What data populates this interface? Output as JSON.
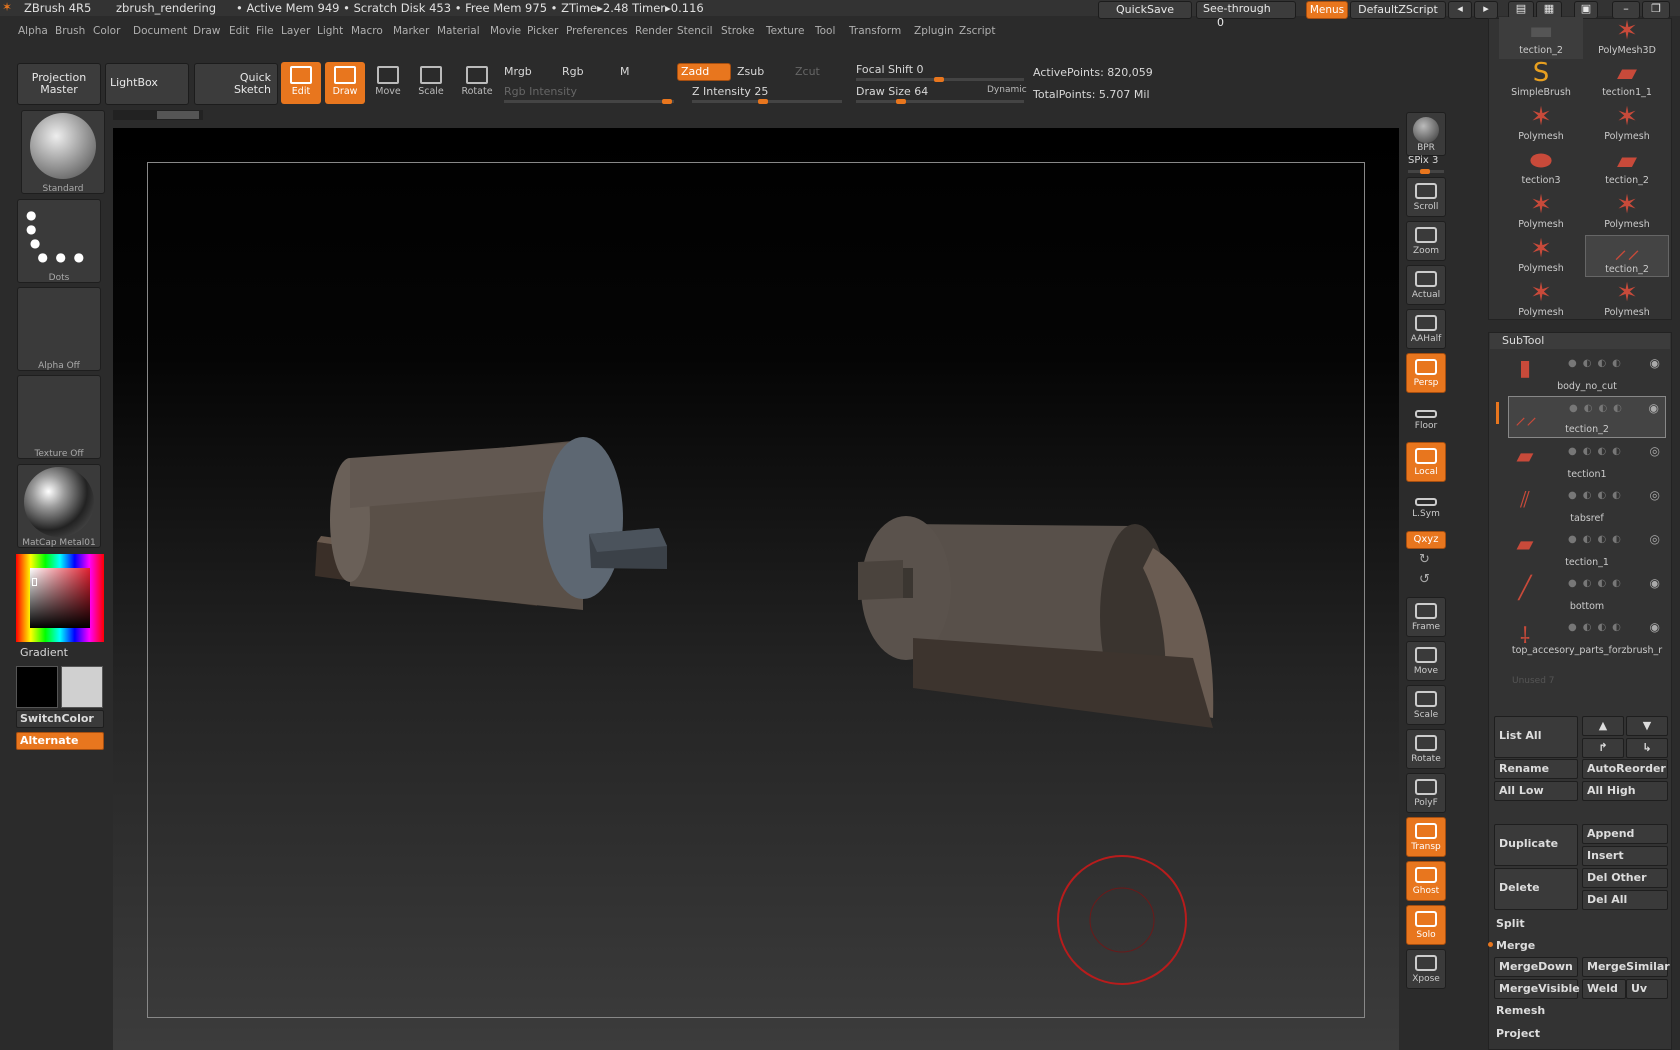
{
  "title": {
    "app": "ZBrush 4R5",
    "doc": "zbrush_rendering",
    "stats": "• Active Mem 949 • Scratch Disk 453 • Free Mem 975 • ZTime▸2.48 Timer▸0.116"
  },
  "topright": {
    "quicksave": "QuickSave",
    "seethrough": "See-through",
    "seethrough_val": "0",
    "menus": "Menus",
    "script": "DefaultZScript"
  },
  "menu": [
    "Alpha",
    "Brush",
    "Color",
    "Document",
    "Draw",
    "Edit",
    "File",
    "Layer",
    "Light",
    "Macro",
    "Marker",
    "Material",
    "Movie",
    "Picker",
    "Preferences",
    "Render",
    "Stencil",
    "Stroke",
    "Texture",
    "Tool",
    "Transform",
    "Zplugin",
    "Zscript"
  ],
  "shelf": {
    "projection": "Projection",
    "master": "Master",
    "lightbox": "LightBox",
    "quick": "Quick",
    "sketch": "Sketch",
    "edit": "Edit",
    "draw": "Draw",
    "move": "Move",
    "scale": "Scale",
    "rotate": "Rotate",
    "mrgb": "Mrgb",
    "rgb": "Rgb",
    "m": "M",
    "zadd": "Zadd",
    "zsub": "Zsub",
    "zcut": "Zcut",
    "rgb_intensity": "Rgb Intensity",
    "z_intensity": "Z Intensity 25",
    "focal_shift": "Focal Shift 0",
    "draw_size": "Draw Size 64",
    "dynamic": "Dynamic",
    "active_points": "ActivePoints: 820,059",
    "total_points": "TotalPoints: 5.707 Mil"
  },
  "left": {
    "brush": "Standard",
    "stroke": "Dots",
    "alpha": "Alpha  Off",
    "texture": "Texture  Off",
    "material": "MatCap  Metal01",
    "gradient": "Gradient",
    "switchcolor": "SwitchColor",
    "alternate": "Alternate"
  },
  "righttools": {
    "bpr": "BPR",
    "spix": "SPix 3",
    "scroll": "Scroll",
    "zoom": "Zoom",
    "actual": "Actual",
    "aahalf": "AAHalf",
    "persp": "Persp",
    "floor": "Floor",
    "local": "Local",
    "lsym": "L.Sym",
    "xyz": "Qxyz",
    "frame": "Frame",
    "move": "Move",
    "scale": "Scale",
    "rotate": "Rotate",
    "polyf": "PolyF",
    "transp": "Transp",
    "ghost": "Ghost",
    "solo": "Solo",
    "xpose": "Xpose"
  },
  "toolgrid": [
    "tection_2",
    "PolyMesh3D",
    "SimpleBrush",
    "tection1_1",
    "Polymesh",
    "Polymesh",
    "tection3",
    "tection_2",
    "Polymesh",
    "Polymesh",
    "Polymesh",
    "tection_2",
    "Polymesh",
    "Polymesh"
  ],
  "subtool": {
    "title": "SubTool",
    "items": [
      "body_no_cut",
      "tection_2",
      "tection1",
      "tabsref",
      "tection_1",
      "bottom",
      "top_accesory_parts_forzbrush_r"
    ],
    "unused": "Unused 7",
    "list_all": "List All",
    "rename": "Rename",
    "autoreorder": "AutoReorder",
    "all_low": "All Low",
    "all_high": "All High",
    "duplicate": "Duplicate",
    "append": "Append",
    "insert": "Insert",
    "delete": "Delete",
    "del_other": "Del Other",
    "del_all": "Del All",
    "split": "Split",
    "merge": "Merge",
    "mergedown": "MergeDown",
    "mergesimilar": "MergeSimilar",
    "mergevisible": "MergeVisible",
    "weld": "Weld",
    "uv": "Uv",
    "remesh": "Remesh",
    "project": "Project"
  },
  "colors": {
    "accent": "#e8761e",
    "panel": "#3a3a3a",
    "bg": "#2b2b2b"
  }
}
